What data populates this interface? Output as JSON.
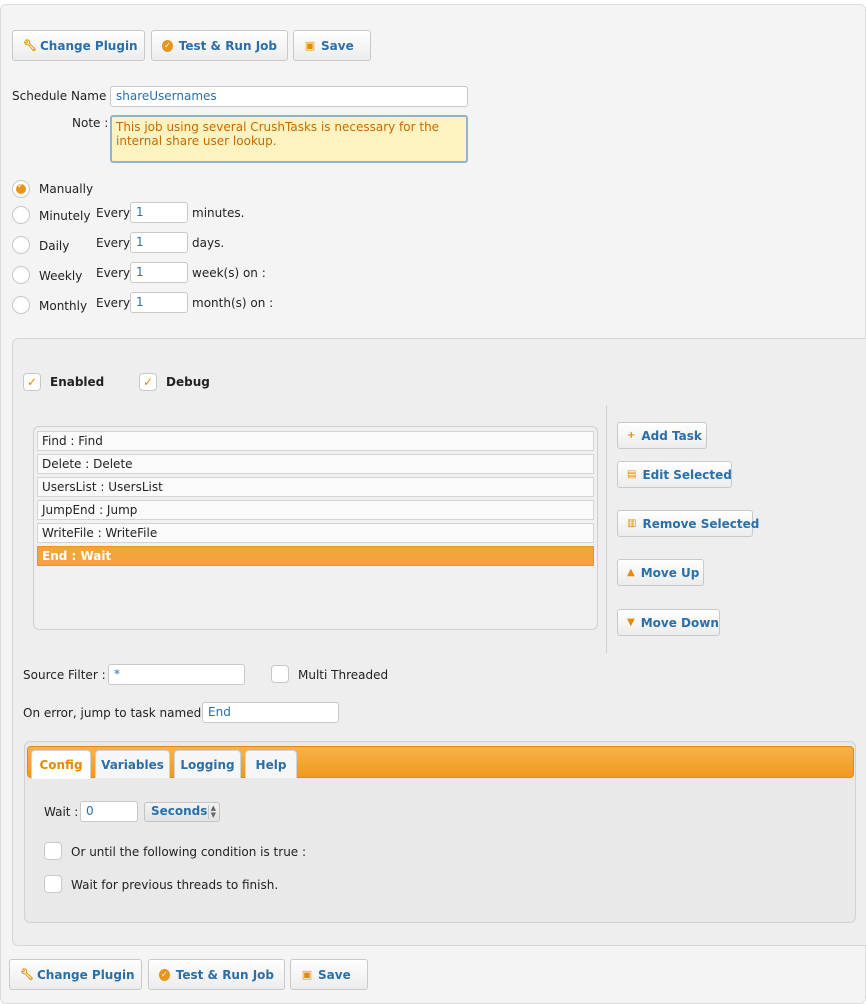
{
  "toolbar_top": {
    "change_plugin": "Change Plugin",
    "test_run": "Test & Run Job",
    "save": "Save"
  },
  "schedule": {
    "name_label": "Schedule Name :",
    "name_value": "shareUsernames",
    "note_label": "Note :",
    "note_value": "This job using several CrushTasks is necessary for the internal share user lookup."
  },
  "frequency": {
    "options": [
      {
        "label": "Manually",
        "selected": true
      },
      {
        "label": "Minutely",
        "every": "Every",
        "value": "1",
        "unit": "minutes."
      },
      {
        "label": "Daily",
        "every": "Every",
        "value": "1",
        "unit": "days."
      },
      {
        "label": "Weekly",
        "every": "Every",
        "value": "1",
        "unit": "week(s) on :"
      },
      {
        "label": "Monthly",
        "every": "Every",
        "value": "1",
        "unit": "month(s) on :"
      }
    ]
  },
  "flags": {
    "enabled": "Enabled",
    "debug": "Debug"
  },
  "tasks": [
    "Find : Find",
    "Delete : Delete",
    "UsersList : UsersList",
    "JumpEnd : Jump",
    "WriteFile : WriteFile",
    "End : Wait"
  ],
  "selected_task": "End : Wait",
  "task_buttons": {
    "add": "Add Task",
    "edit": "Edit Selected",
    "remove": "Remove Selected",
    "up": "Move Up",
    "down": "Move Down"
  },
  "filters": {
    "source_filter_label": "Source Filter :",
    "source_filter_value": "*",
    "multi_threaded_label": "Multi Threaded",
    "on_error_label": "On error, jump to task named :",
    "on_error_value": "End"
  },
  "tabs": [
    "Config",
    "Variables",
    "Logging",
    "Help"
  ],
  "active_tab": "Config",
  "config": {
    "wait_label": "Wait :",
    "wait_value": "0",
    "wait_unit": "Seconds",
    "condition_label": "Or until the following condition is true :",
    "threads_label": "Wait for previous threads to finish."
  },
  "toolbar_bottom": {
    "change_plugin": "Change Plugin",
    "test_run": "Test & Run Job",
    "save": "Save"
  },
  "colors": {
    "accent": "#e8951e",
    "link": "#2b6fa8",
    "note_bg": "#fdf3c0"
  }
}
